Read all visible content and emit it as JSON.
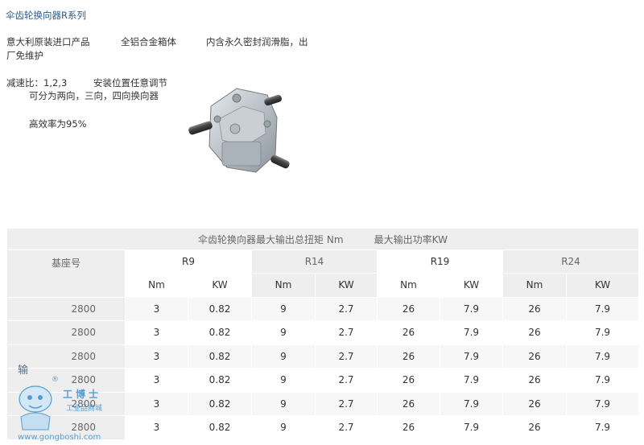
{
  "title": "伞齿轮换向器R系列",
  "features": {
    "line1_a": "意大利原装进口产品",
    "line1_b": "全铝合金箱体",
    "line1_c": "内含永久密封润滑脂，出",
    "line2": "厂免维护",
    "line3_a": "减速比：1,2,3",
    "line3_b": "安装位置任意调节",
    "line4": "可分为两向，三向，四向换向器",
    "line5": "高效率为95%"
  },
  "table": {
    "caption": "伞齿轮换向器最大输出总扭矩 Nm          最大输出功率KW",
    "base_label": "基座号",
    "models": [
      "R9",
      "R14",
      "R19",
      "R24"
    ],
    "units": [
      "Nm",
      "KW",
      "Nm",
      "KW",
      "Nm",
      "KW",
      "Nm",
      "KW"
    ],
    "rows": [
      {
        "base": "2800",
        "values": [
          "3",
          "0.82",
          "9",
          "2.7",
          "26",
          "7.9",
          "26",
          "7.9"
        ]
      },
      {
        "base": "2800",
        "values": [
          "3",
          "0.82",
          "9",
          "2.7",
          "26",
          "7.9",
          "26",
          "7.9"
        ]
      },
      {
        "base": "2800",
        "values": [
          "3",
          "0.82",
          "9",
          "2.7",
          "26",
          "7.9",
          "26",
          "7.9"
        ]
      },
      {
        "base": "2800",
        "values": [
          "3",
          "0.82",
          "9",
          "2.7",
          "26",
          "7.9",
          "26",
          "7.9"
        ]
      },
      {
        "base": "2800",
        "values": [
          "3",
          "0.82",
          "9",
          "2.7",
          "26",
          "7.9",
          "26",
          "7.9"
        ]
      },
      {
        "base": "2800",
        "values": [
          "3",
          "0.82",
          "9",
          "2.7",
          "26",
          "7.9",
          "26",
          "7.9"
        ]
      }
    ]
  },
  "watermark": {
    "brand_cn": "工博士",
    "sub_cn": "工业品商城",
    "url": "www.gongboshi.com",
    "side_text": "输",
    "registered": "®"
  },
  "colors": {
    "title": "#2a5a8a",
    "table_header_bg": "#eeeeee",
    "row_alt_bg": "#f7f7f7",
    "watermark_blue": "#3a8fd0"
  }
}
